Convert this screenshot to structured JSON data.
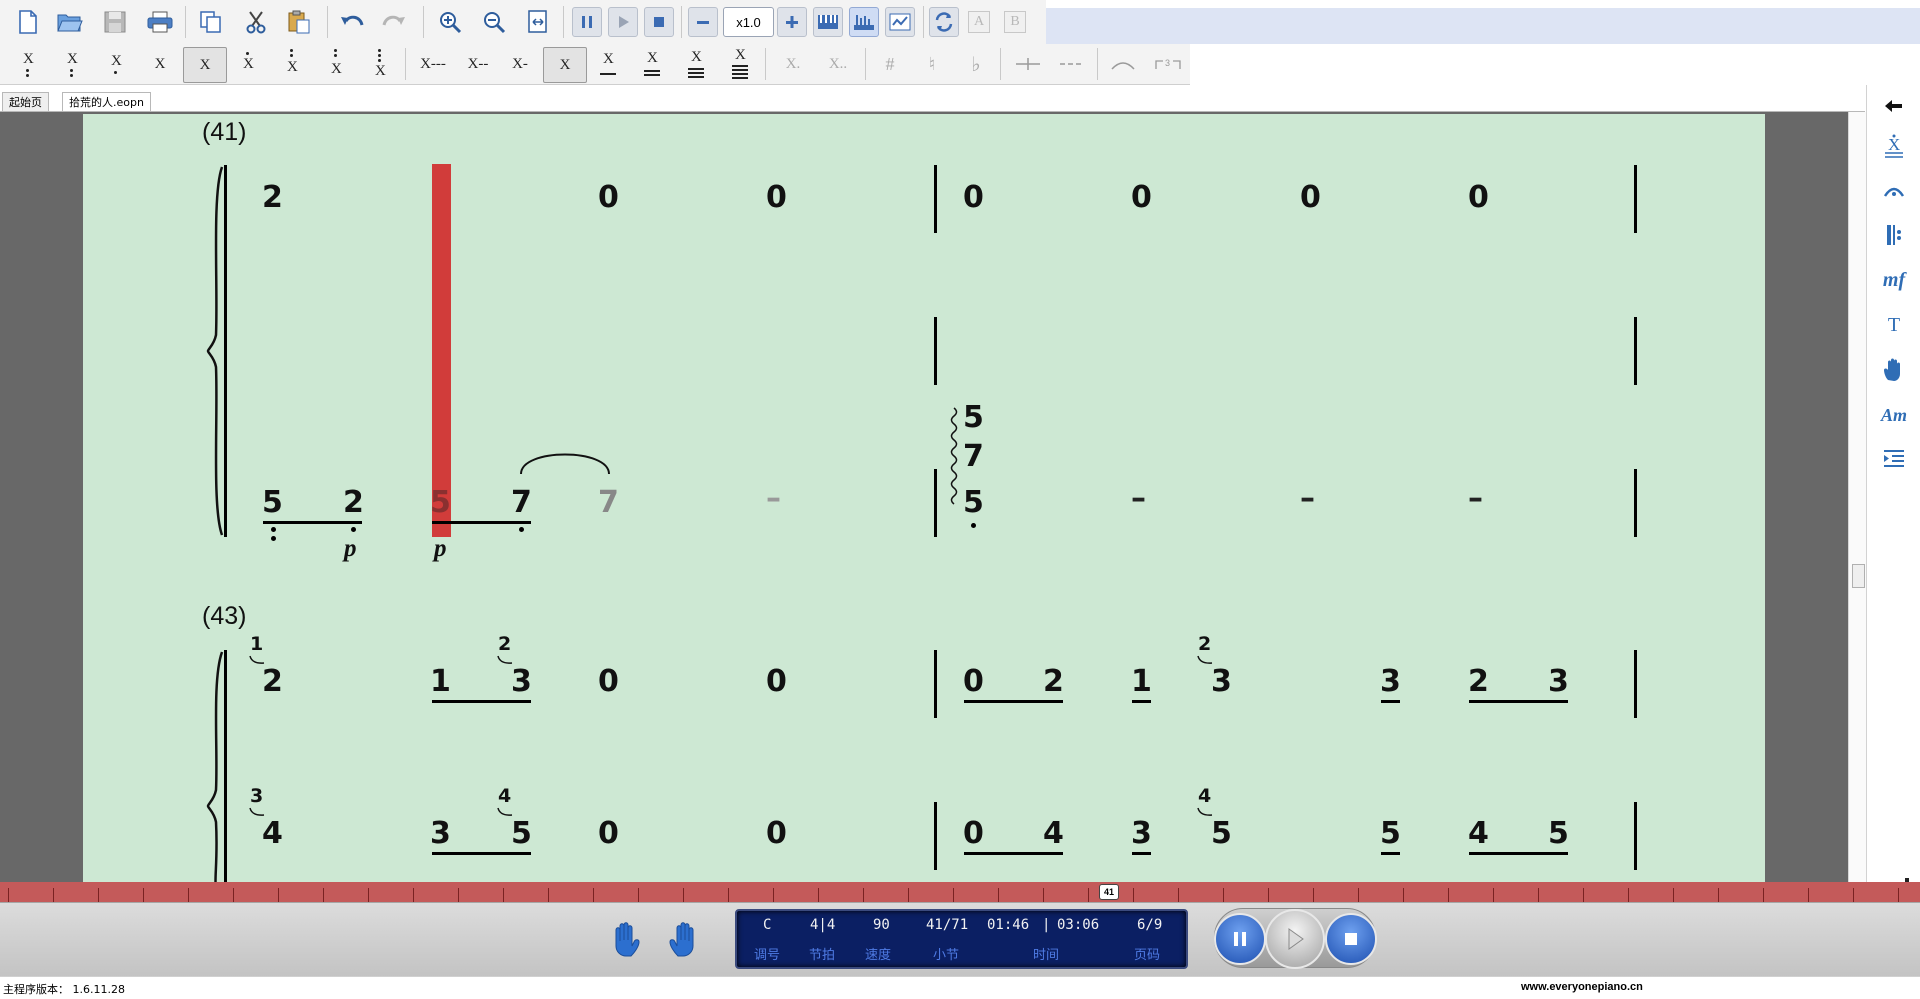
{
  "toolbar": {
    "zoom_value": "x1.0",
    "buttons": [
      "new",
      "open",
      "save",
      "print",
      "copy",
      "cut",
      "paste",
      "undo",
      "redo",
      "zoom-in",
      "zoom-out",
      "fit-page",
      "pause",
      "play",
      "stop",
      "speed-down",
      "speed-up",
      "keyboard-view",
      "staff-view",
      "score-view",
      "convert",
      "A",
      "B"
    ],
    "letter_a": "A",
    "letter_b": "B"
  },
  "notation_toolbar": {
    "durations": [
      "X",
      "X",
      "X",
      "X",
      "X",
      "X",
      "X",
      "X",
      "X"
    ],
    "extend": [
      "X---",
      "X--",
      "X-"
    ],
    "plain": "X",
    "underlines": [
      "X",
      "X",
      "X",
      "X"
    ],
    "dots": [
      "X.",
      "X.."
    ],
    "accidentals": [
      "#",
      "♮",
      "♭"
    ]
  },
  "tabs": [
    {
      "label": "起始页",
      "active": false
    },
    {
      "label": "拾荒的人.eopn",
      "active": true
    }
  ],
  "score": {
    "measure_label_1": "(41)",
    "measure_label_2": "(43)",
    "sys1": {
      "top": [
        "2",
        "0",
        "0",
        "0",
        "0",
        "0",
        "0"
      ],
      "bottom_pre": [
        "5",
        "2",
        "5",
        "7",
        "7"
      ],
      "chord": [
        "5",
        "7",
        "5"
      ],
      "dynamics": [
        "p",
        "p"
      ]
    },
    "sys2": {
      "top_notes": [
        "2",
        "1",
        "3",
        "0",
        "0",
        "0",
        "2",
        "1",
        "3",
        "3",
        "2",
        "3"
      ],
      "bottom_notes": [
        "4",
        "3",
        "5",
        "0",
        "0",
        "0",
        "4",
        "3",
        "5",
        "5",
        "4",
        "5"
      ],
      "top_fingers": [
        "1",
        "2",
        "2"
      ],
      "bottom_fingers": [
        "3",
        "4",
        "4"
      ]
    }
  },
  "timeline": {
    "marker": "41"
  },
  "lcd": {
    "key": "C",
    "meter": "4|4",
    "tempo": "90",
    "measure": "41/71",
    "time_elapsed": "01:46",
    "time_sep": "|",
    "time_total": "03:06",
    "page": "6/9",
    "labels": {
      "key": "调号",
      "meter": "节拍",
      "tempo": "速度",
      "measure": "小节",
      "time": "时间",
      "page": "页码"
    }
  },
  "status": {
    "version_label": "主程序版本：",
    "version": "1.6.11.28",
    "website": "www.everyonepiano.cn"
  },
  "colors": {
    "page_bg": "#cde8d3",
    "cursor": "#d12c2c",
    "lcd_bg": "#0b1f63",
    "lcd_label": "#4f7be4",
    "palette_icon": "#2f6db5",
    "hand_icon": "#2c6fcf"
  },
  "palette": [
    "arrow-left-icon",
    "note-style-icon",
    "slur-icon",
    "repeat-icon",
    "dynamics-mf-icon",
    "text-T-icon",
    "hand-icon",
    "chord-Am-icon",
    "indent-icon"
  ],
  "palette_text": {
    "mf": "mf",
    "T": "T",
    "Am": "Am"
  }
}
